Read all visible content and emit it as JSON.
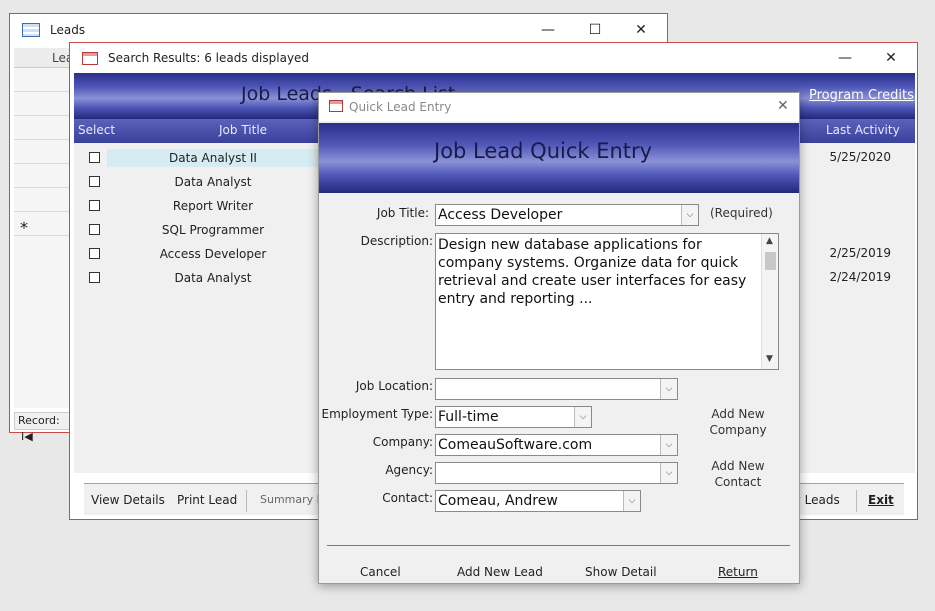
{
  "leads_window": {
    "title": "Leads",
    "minimize": "—",
    "maximize": "☐",
    "close": "✕",
    "col_header": "Lea",
    "new_row_marker": "*",
    "record_label": "Record:",
    "record_nav": "I◀"
  },
  "search_window": {
    "title": "Search Results:  6 leads displayed",
    "minimize": "—",
    "close": "✕",
    "banner_title": "Job Leads - Search List",
    "program_credits": "Program Credits",
    "columns": {
      "select": "Select",
      "job_title": "Job Title",
      "last_activity": "Last Activity"
    },
    "rows": [
      {
        "job_title": "Data Analyst II",
        "last_activity": "5/25/2020"
      },
      {
        "job_title": "Data Analyst",
        "last_activity": ""
      },
      {
        "job_title": "Report Writer",
        "last_activity": ""
      },
      {
        "job_title": "SQL Programmer",
        "last_activity": ""
      },
      {
        "job_title": "Access Developer",
        "last_activity": "2/25/2019"
      },
      {
        "job_title": "Data Analyst",
        "last_activity": "2/24/2019"
      }
    ],
    "footer": {
      "view_details": "View Details",
      "print_lead": "Print Lead",
      "summary": "Summary Re",
      "new_leads": "w Leads",
      "exit": "Exit"
    }
  },
  "quick_entry": {
    "title": "Quick Lead Entry",
    "close": "✕",
    "banner_title": "Job Lead Quick Entry",
    "labels": {
      "job_title": "Job Title:",
      "description": "Description:",
      "job_location": "Job Location:",
      "employment_type": "Employment Type:",
      "company": "Company:",
      "agency": "Agency:",
      "contact": "Contact:"
    },
    "values": {
      "job_title": "Access Developer",
      "description": "Design new database applications for company systems.  Organize data for quick retrieval and create user interfaces for easy entry and reporting ...",
      "job_location": "",
      "employment_type": "Full-time",
      "company": "ComeauSoftware.com",
      "agency": "",
      "contact": "Comeau, Andrew"
    },
    "required_note": "(Required)",
    "add_new_company": "Add New Company",
    "add_new_contact": "Add New Contact",
    "buttons": {
      "cancel": "Cancel",
      "add_new_lead": "Add New Lead",
      "show_detail": "Show Detail",
      "return": "Return"
    },
    "dropdown_glyph": "⌵"
  },
  "colors": {
    "window_border": "#c94a4a",
    "banner_dark": "#2a2f8a",
    "banner_light": "#8a92d6",
    "selected_row": "#d7ecf2"
  }
}
